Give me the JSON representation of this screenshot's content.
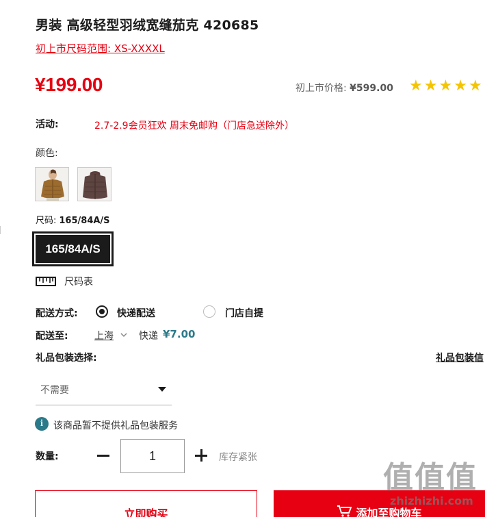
{
  "product": {
    "title": "男装 高级轻型羽绒宽缝茄克 420685",
    "size_range": "初上市尺码范围: XS-XXXXL",
    "price": "¥199.00",
    "orig_price_label": "初上市价格:",
    "orig_price": "¥599.00",
    "rating_stars": 5
  },
  "promo": {
    "label": "活动:",
    "text": "2.7-2.9会员狂欢 周末免邮购（门店急送除外）"
  },
  "colors": {
    "label": "颜色:",
    "swatches": [
      "brown-jacket-model",
      "dark-brown-jacket"
    ]
  },
  "size": {
    "label": "尺码:",
    "selected": "165/84A/S",
    "button": "165/84A/S",
    "chart_link": "尺码表"
  },
  "shipping": {
    "label": "配送方式:",
    "option_express": "快递配送",
    "option_pickup": "门店自提",
    "dest_label": "配送至:",
    "city": "上海",
    "method": "快递",
    "fee": "¥7.00"
  },
  "gift": {
    "label": "礼品包装选择:",
    "info_link": "礼品包装信",
    "select_value": "不需要",
    "notice": "该商品暂不提供礼品包装服务"
  },
  "quantity": {
    "label": "数量:",
    "value": "1",
    "stock": "库存紧张"
  },
  "actions": {
    "buy_now": "立即购买",
    "add_to_cart": "添加至购物车"
  },
  "watermark": {
    "big": "值值值",
    "small": "zhizhizhi.com"
  },
  "colors_theme": {
    "accent": "#e60012",
    "teal": "#2b7a8a",
    "star": "#f5c400"
  }
}
